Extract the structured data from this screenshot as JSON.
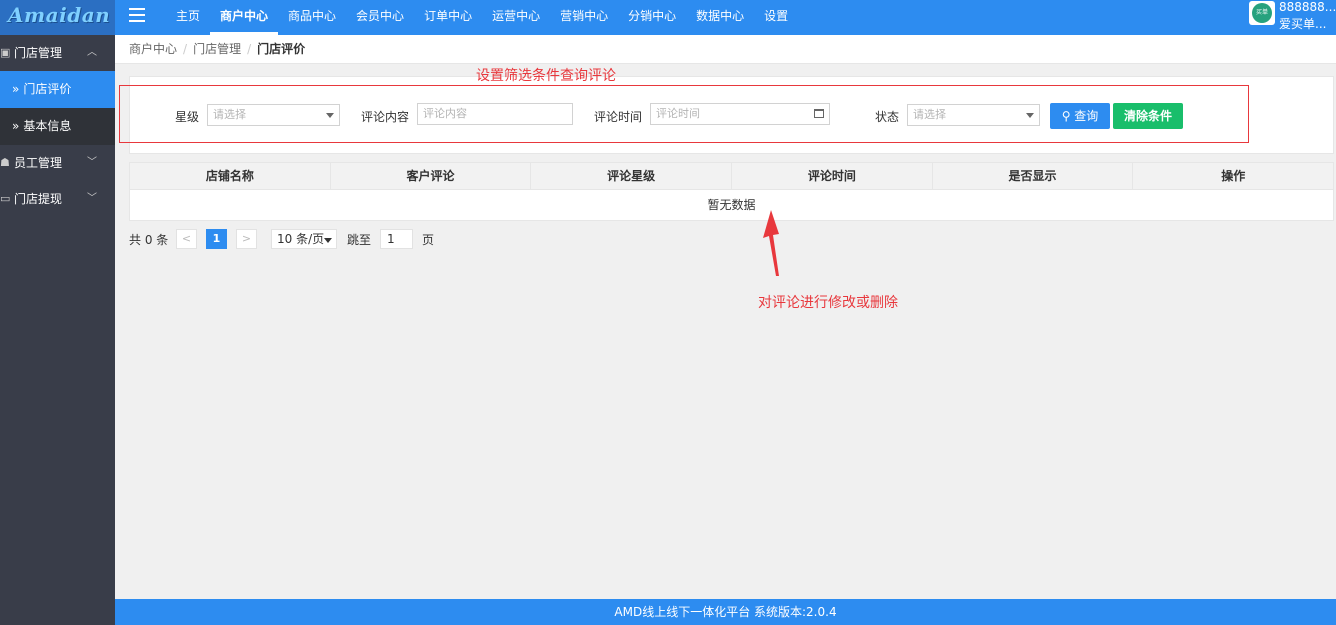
{
  "app": {
    "logo": "Amaidan",
    "menu_icon": "hamburger-icon"
  },
  "top_nav": [
    "主页",
    "商户中心",
    "商品中心",
    "会员中心",
    "订单中心",
    "运营中心",
    "营销中心",
    "分销中心",
    "数据中心",
    "设置"
  ],
  "top_nav_active": "商户中心",
  "user": {
    "id": "888888...",
    "name": "爱买单...",
    "avatar_text": "买单"
  },
  "sidebar": {
    "groups": [
      {
        "label": "门店管理",
        "icon": "store-icon",
        "expanded": true
      },
      {
        "label": "员工管理",
        "icon": "users-icon",
        "expanded": false
      },
      {
        "label": "门店提现",
        "icon": "cash-icon",
        "expanded": false
      }
    ],
    "sub_items": [
      {
        "label": "门店评价",
        "active": true
      },
      {
        "label": "基本信息",
        "active": false
      }
    ]
  },
  "breadcrumb": [
    "商户中心",
    "门店管理",
    "门店评价"
  ],
  "annotations": {
    "filter_note": "设置筛选条件查询评论",
    "action_note": "对评论进行修改或删除",
    "color": "#e8383d"
  },
  "filters": {
    "star": {
      "label": "星级",
      "placeholder": "请选择"
    },
    "content": {
      "label": "评论内容",
      "placeholder": "评论内容"
    },
    "time": {
      "label": "评论时间",
      "placeholder": "评论时间"
    },
    "status": {
      "label": "状态",
      "placeholder": "请选择"
    },
    "search_button": "查询",
    "clear_button": "清除条件"
  },
  "table": {
    "columns": [
      "店铺名称",
      "客户评论",
      "评论星级",
      "评论时间",
      "是否显示",
      "操作"
    ],
    "empty_text": "暂无数据"
  },
  "pagination": {
    "total": "共 0 条",
    "prev": "<",
    "current": "1",
    "next": ">",
    "page_size": "10 条/页",
    "jump_label": "跳至",
    "jump_value": "1",
    "page_label": "页"
  },
  "footer": "AMD线上线下一体化平台 系统版本:2.0.4",
  "colors": {
    "primary": "#2d8cf0",
    "sidebar": "#393d49",
    "success": "#19be6b"
  }
}
